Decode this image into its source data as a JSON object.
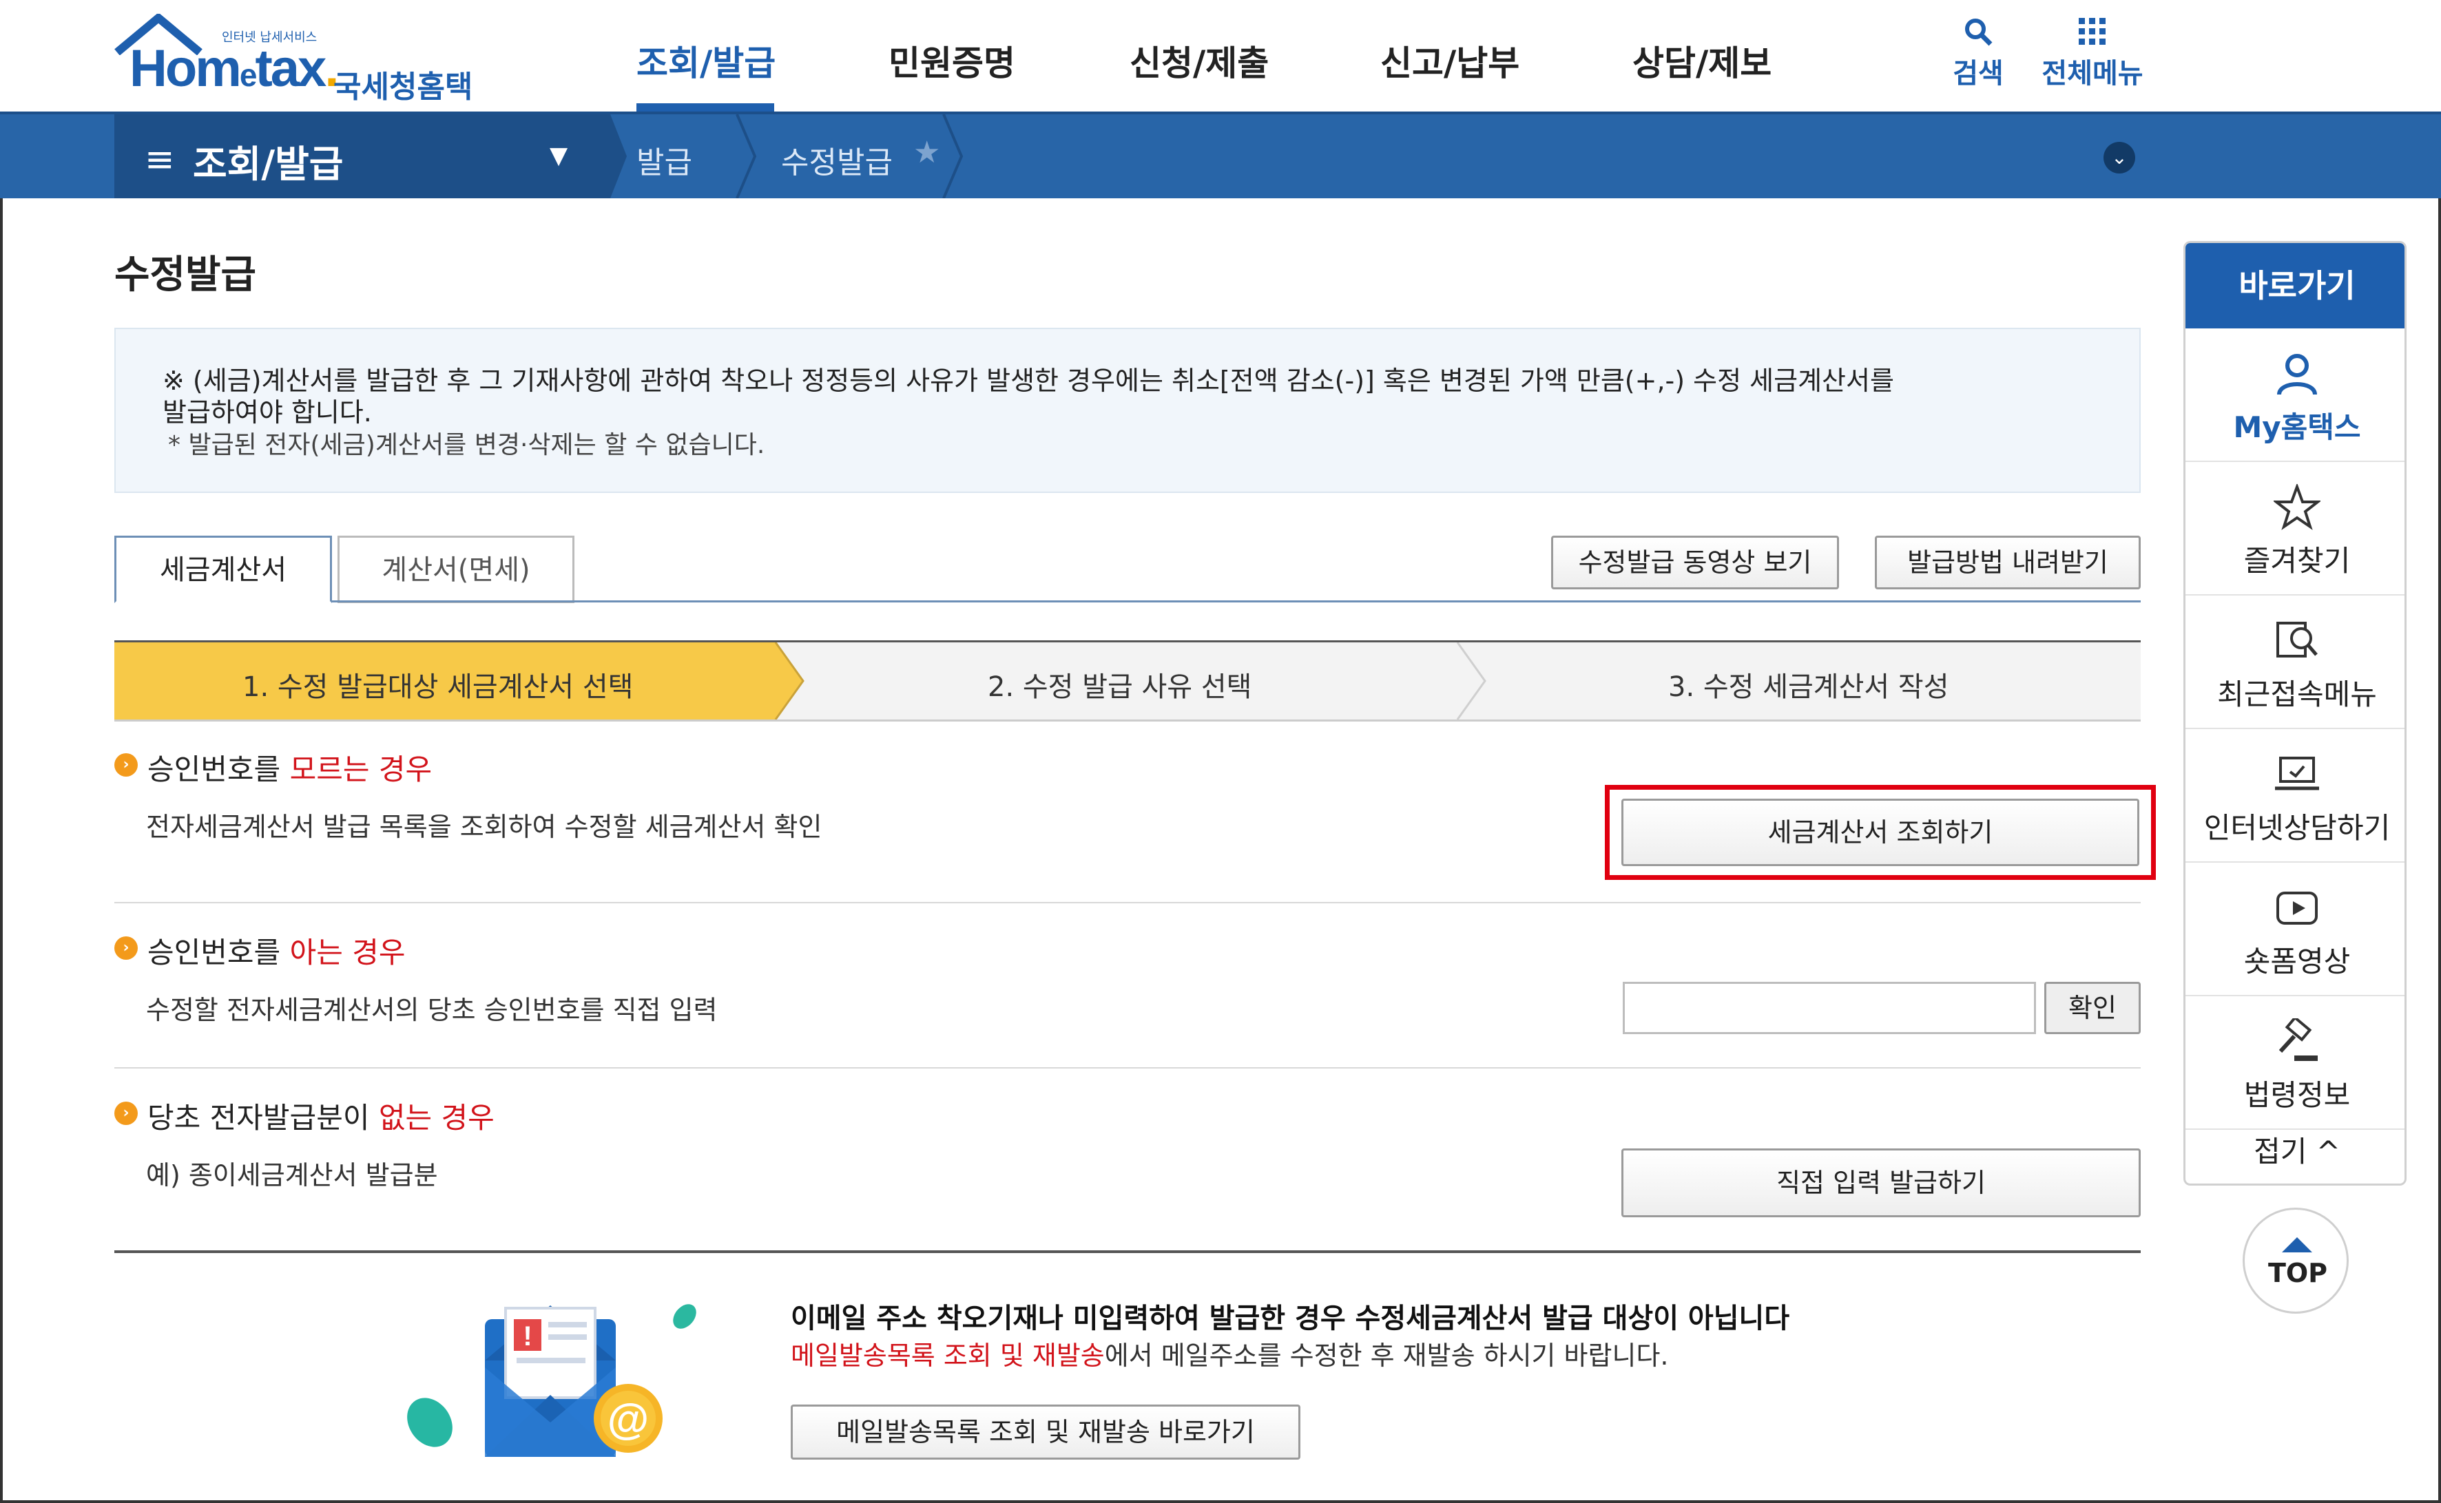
{
  "header": {
    "logo_small": "인터넷 납세서비스",
    "logo_brand_1": "Hom",
    "logo_brand_e": "e",
    "logo_brand_2": "tax",
    "logo_brand_dot": ".",
    "logo_korean": "국세청홈택스",
    "menu": [
      "조회/발급",
      "민원증명",
      "신청/제출",
      "신고/납부",
      "상담/제보"
    ],
    "active_menu": "조회/발급",
    "search_label": "검색",
    "all_menu_label": "전체메뉴"
  },
  "location": {
    "hamburger": "≡",
    "section": "조회/발급",
    "crumbs": [
      "발급",
      "수정발급"
    ],
    "star": "★",
    "expand": "⌄"
  },
  "page": {
    "title": "수정발급",
    "notice_line1": "※ (세금)계산서를 발급한 후 그 기재사항에 관하여 착오나 정정등의 사유가 발생한 경우에는 취소[전액 감소(-)] 혹은 변경된 가액 만큼(+,-) 수정 세금계산서를",
    "notice_line1b": "발급하여야 합니다.",
    "notice_line2": "* 발급된 전자(세금)계산서를 변경·삭제는 할 수 없습니다."
  },
  "tabs": [
    "세금계산서",
    "계산서(면세)"
  ],
  "actions": {
    "video": "수정발급 동영상 보기",
    "download": "발급방법 내려받기"
  },
  "steps": [
    "1. 수정 발급대상 세금계산서 선택",
    "2. 수정 발급 사유 선택",
    "3. 수정 세금계산서 작성"
  ],
  "sections": [
    {
      "title_a": "승인번호를 ",
      "title_red": "모르는 경우",
      "desc": "전자세금계산서 발급 목록을 조회하여 수정할 세금계산서 확인",
      "button": "세금계산서 조회하기"
    },
    {
      "title_a": "승인번호를 ",
      "title_red": "아는 경우",
      "desc": "수정할 전자세금계산서의 당초 승인번호를 직접 입력",
      "input_value": "",
      "button": "확인"
    },
    {
      "title_a": "당초 전자발급분이 ",
      "title_red": "없는 경우",
      "desc": "예) 종이세금계산서 발급분",
      "button": "직접 입력 발급하기"
    }
  ],
  "mail_notice": {
    "line1": "이메일 주소 착오기재나 미입력하여 발급한 경우 수정세금계산서 발급 대상이 아닙니다",
    "line2_red": "메일발송목록 조회 및 재발송",
    "line2_rest": "에서 메일주소를 수정한 후 재발송 하시기 바랍니다.",
    "button": "메일발송목록 조회 및 재발송 바로가기"
  },
  "quick": {
    "title": "바로가기",
    "items": [
      "My홈택스",
      "즐겨찾기",
      "최근접속메뉴",
      "인터넷상담하기",
      "숏폼영상",
      "법령정보"
    ],
    "fold": "접기 ^",
    "top": "TOP"
  },
  "colors": {
    "brand_blue": "#1e5fae",
    "location_bar": "#2865a8",
    "step_active": "#f7c948",
    "highlight_red": "#e00010",
    "bullet_orange": "#f39a1b"
  }
}
